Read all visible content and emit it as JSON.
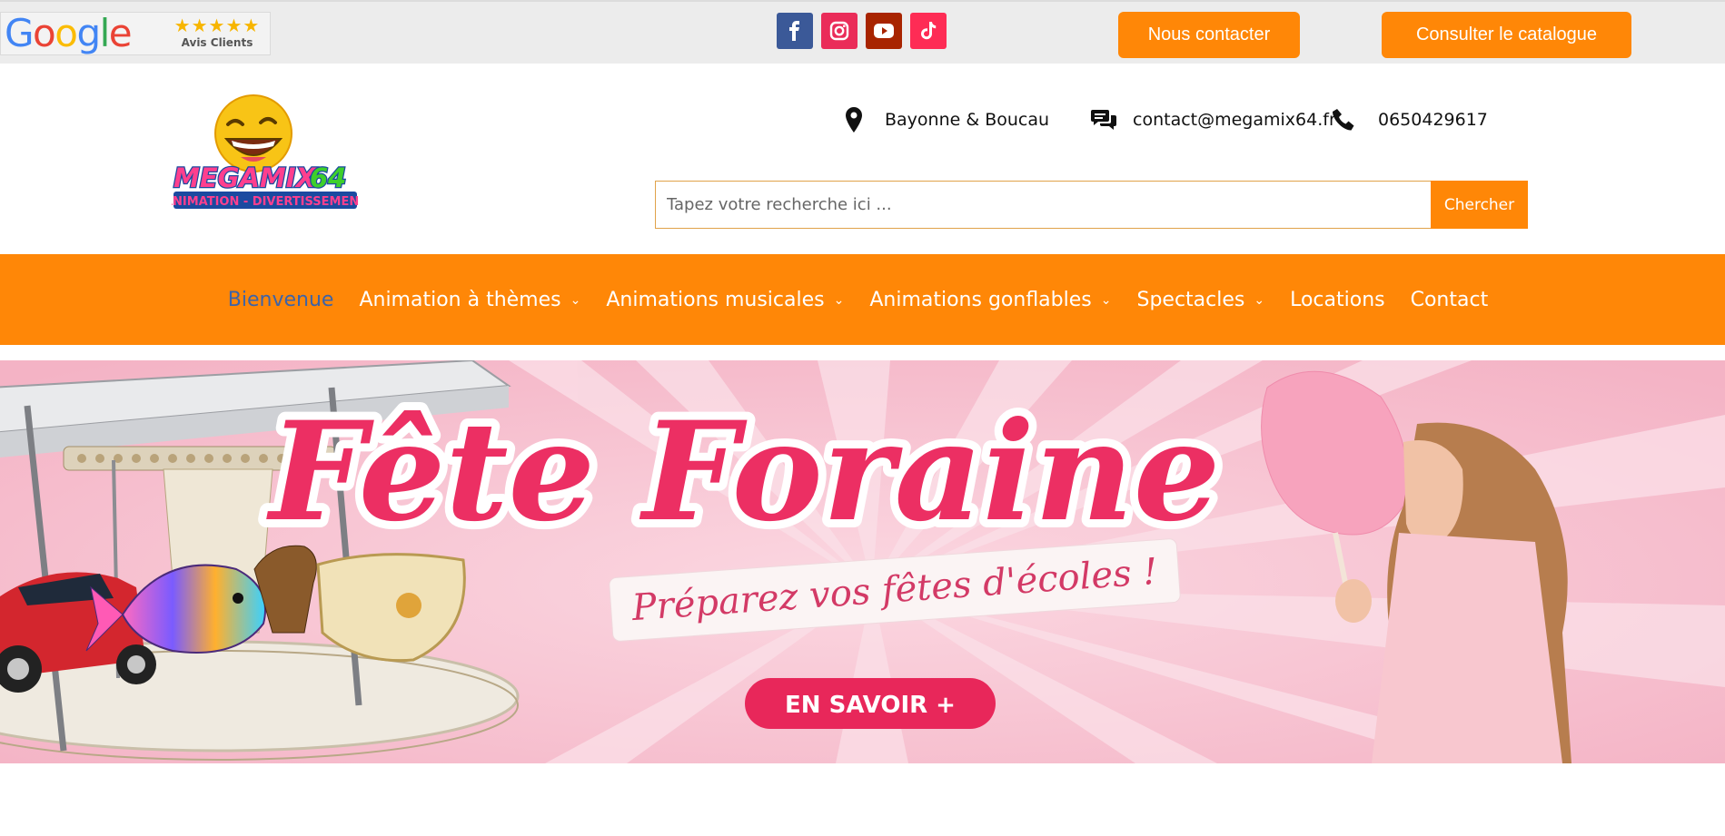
{
  "topbar": {
    "google_badge": {
      "brand": "Google",
      "stars": "★★★★★",
      "label": "Avis Clients"
    },
    "social_icons": [
      "facebook-icon",
      "instagram-icon",
      "youtube-icon",
      "tiktok-icon"
    ],
    "contact_button": "Nous contacter",
    "catalogue_button": "Consulter le catalogue"
  },
  "header": {
    "logo": {
      "name": "MEGAMIX64",
      "tagline": "ANIMATION - DIVERTISSEMENT"
    },
    "location": "Bayonne & Boucau",
    "email": "contact@megamix64.fr",
    "phone": "0650429617",
    "search": {
      "placeholder": "Tapez votre recherche ici ...",
      "button": "Chercher"
    }
  },
  "nav": {
    "items": [
      {
        "label": "Bienvenue",
        "dropdown": false
      },
      {
        "label": "Animation à thèmes",
        "dropdown": true
      },
      {
        "label": "Animations musicales",
        "dropdown": true
      },
      {
        "label": "Animations gonflables",
        "dropdown": true
      },
      {
        "label": "Spectacles",
        "dropdown": true
      },
      {
        "label": "Locations",
        "dropdown": false
      },
      {
        "label": "Contact",
        "dropdown": false
      }
    ]
  },
  "banner": {
    "title": "Fête Foraine",
    "subtitle": "Préparez vos fêtes d'écoles !",
    "cta": "EN SAVOIR +"
  },
  "colors": {
    "accent": "#ff8707",
    "active_nav": "#3d63a8",
    "banner_pink": "#f6bccb",
    "title_pink": "#ec2f63"
  }
}
